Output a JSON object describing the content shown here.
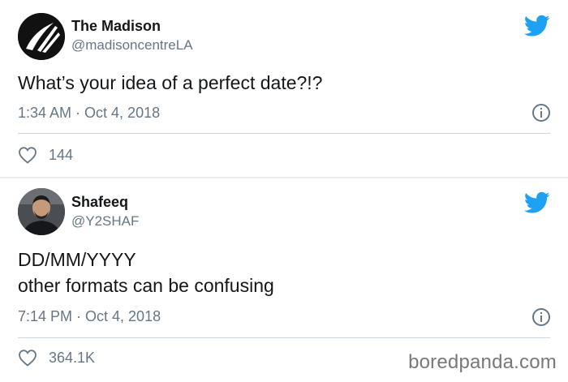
{
  "colors": {
    "twitter_blue": "#1da1f2",
    "secondary_text": "#657786",
    "primary_text": "#14171a"
  },
  "tweets": [
    {
      "name": "The Madison",
      "handle": "@madisoncentreLA",
      "text_lines": [
        "What’s your idea of a perfect date?!?"
      ],
      "timestamp": "1:34 AM · Oct 4, 2018",
      "likes": "144",
      "avatar_icon": "madison-logo-icon"
    },
    {
      "name": "Shafeeq",
      "handle": "@Y2SHAF",
      "text_lines": [
        "DD/MM/YYYY",
        "other formats can be confusing"
      ],
      "timestamp": "7:14 PM · Oct 4, 2018",
      "likes": "364.1K",
      "avatar_icon": "user-photo-avatar"
    }
  ],
  "watermark": "boredpanda.com"
}
